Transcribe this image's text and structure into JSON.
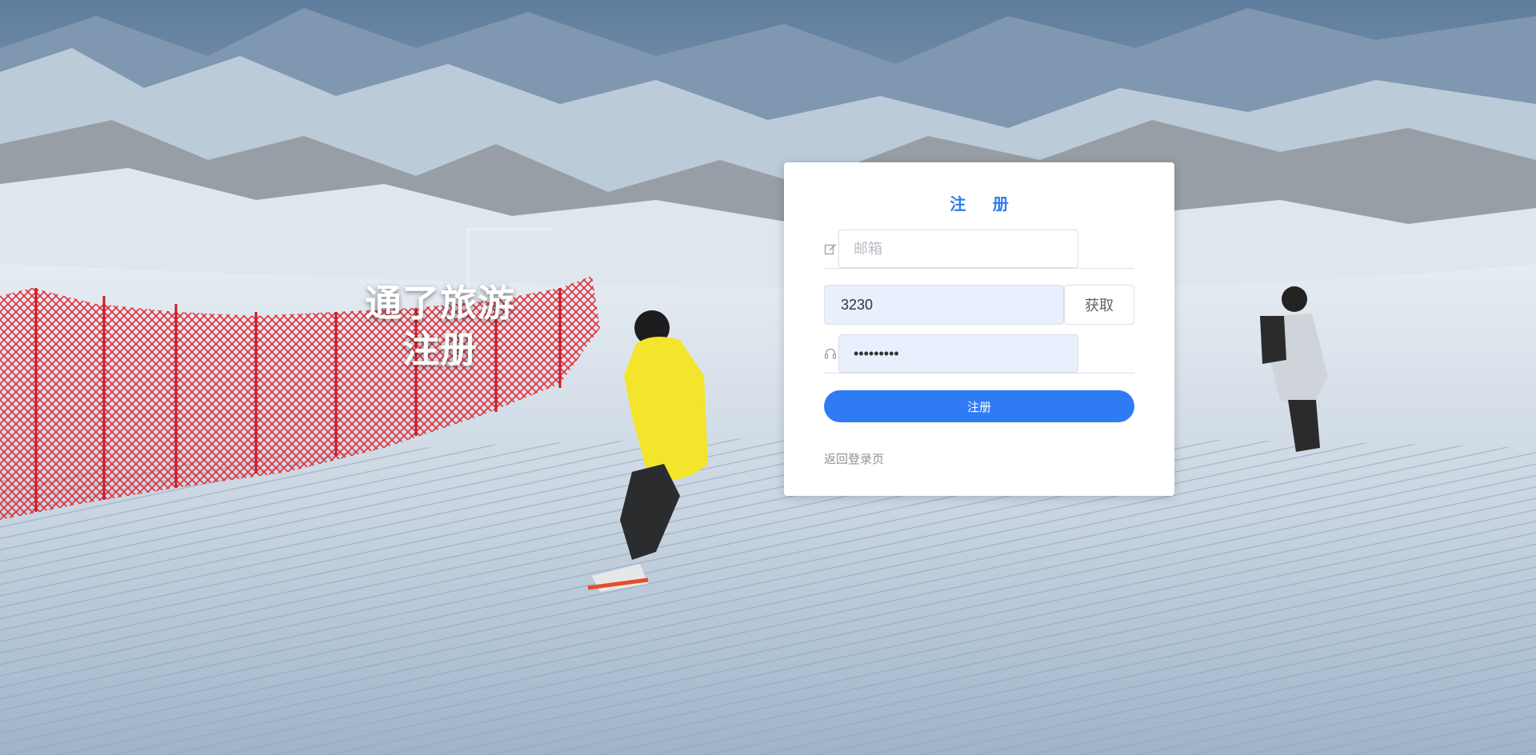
{
  "brand": {
    "line1": "通了旅游",
    "line2": "注册"
  },
  "form": {
    "title": "注 册",
    "email": {
      "placeholder": "邮箱",
      "value": ""
    },
    "code": {
      "value": "3230",
      "button_label": "获取"
    },
    "password": {
      "value": "•••••••••"
    },
    "submit_label": "注册",
    "back_link": "返回登录页"
  },
  "colors": {
    "accent": "#2f7bf5",
    "title": "#2f7bf0",
    "autofill_bg": "#e8f0fe"
  },
  "icons": {
    "email": "edit-icon",
    "password": "headset-icon"
  }
}
